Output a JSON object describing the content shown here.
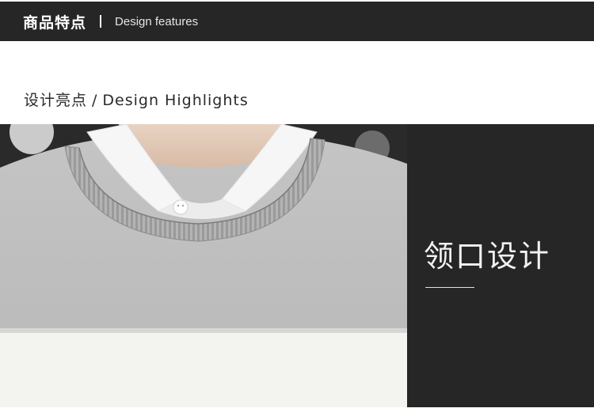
{
  "header": {
    "title_cn": "商品特点",
    "title_en": "Design features"
  },
  "section": {
    "title_cn": "设计亮点",
    "divider": "/",
    "title_en": "Design Highlights"
  },
  "feature": {
    "title": "领口设计"
  },
  "colors": {
    "header_bg": "#262626",
    "panel_bg": "#262626",
    "sweater_gray": "#bdbdbd",
    "sweater_stripe": "#f4f4f2"
  }
}
